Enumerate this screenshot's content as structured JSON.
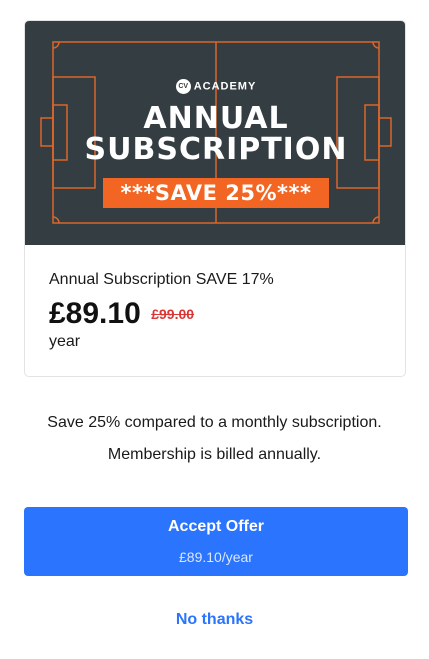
{
  "banner": {
    "brand_logo": "CV",
    "brand_name": "ACADEMY",
    "headline_line1": "ANNUAL",
    "headline_line2": "SUBSCRIPTION",
    "badge": "***SAVE 25%***",
    "background_color": "#343d42",
    "pitch_line_color": "#d9672a",
    "badge_color": "#f26522"
  },
  "product": {
    "title": "Annual Subscription SAVE 17%",
    "price": "£89.10",
    "original_price": "£99.00",
    "period": "year"
  },
  "description": {
    "line1": "Save 25% compared to a monthly subscription.",
    "line2": "Membership is billed annually."
  },
  "accept_button": {
    "label": "Accept Offer",
    "sublabel": "£89.10/year",
    "color": "#2b74fe"
  },
  "decline_link": {
    "label": "No thanks"
  }
}
